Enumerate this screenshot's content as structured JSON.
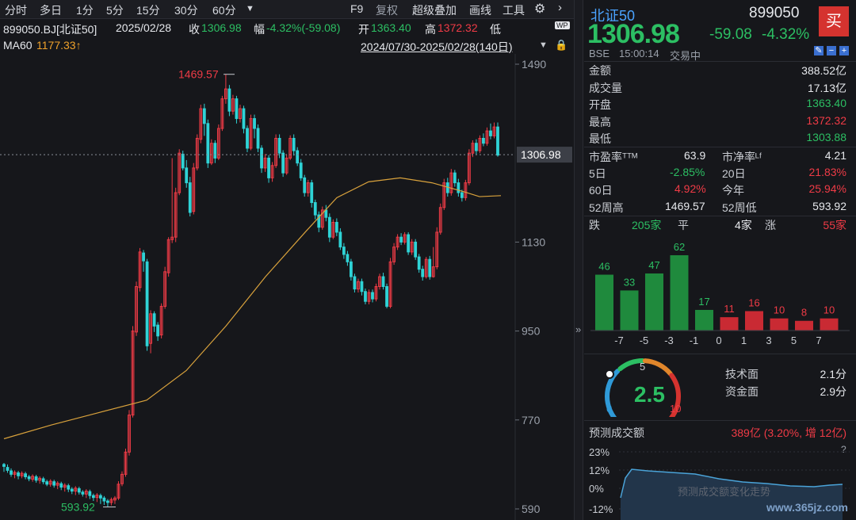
{
  "toolbar": {
    "periods": [
      "分时",
      "多日",
      "1分",
      "5分",
      "15分",
      "30分",
      "60分"
    ],
    "more_icon": "caret-down-icon",
    "f9": "F9",
    "restore": "复权",
    "overlay": "超级叠加",
    "draw": "画线",
    "tools": "工具",
    "settings_icon": "gear-icon",
    "next_icon": "chevron-right-icon"
  },
  "info": {
    "code": "899050.BJ[北证50]",
    "date": "2025/02/28",
    "close_label": "收",
    "close": "1306.98",
    "change_label": "幅",
    "change": "-4.32%(-59.08)",
    "open_label": "开",
    "open": "1363.40",
    "high_label": "高",
    "high": "1372.32",
    "low_label": "低",
    "ma_label": "MA60",
    "ma_value": "1177.33↑",
    "range": "2024/07/30-2025/02/28(140日)",
    "wp_icon": "WP"
  },
  "chart_data": {
    "type": "candlestick",
    "y_ticks": [
      "1490",
      "1130",
      "950",
      "770",
      "590"
    ],
    "ylim": [
      590,
      1490
    ],
    "current_price_label": "1306.98",
    "high_annotation": "1469.57",
    "low_annotation": "593.92",
    "ma_series": "MA60",
    "colors": {
      "up": "#ef3b46",
      "down": "#2fd3d6",
      "ma": "#d9a23c"
    },
    "candles": [
      [
        680,
        676,
        683,
        665
      ],
      [
        674,
        668,
        680,
        663
      ],
      [
        667,
        660,
        672,
        655
      ],
      [
        660,
        664,
        668,
        652
      ],
      [
        663,
        657,
        667,
        650
      ],
      [
        657,
        662,
        666,
        652
      ],
      [
        661,
        655,
        665,
        650
      ],
      [
        655,
        651,
        659,
        646
      ],
      [
        650,
        656,
        660,
        645
      ],
      [
        655,
        648,
        659,
        643
      ],
      [
        648,
        652,
        656,
        641
      ],
      [
        651,
        645,
        655,
        640
      ],
      [
        645,
        640,
        649,
        636
      ],
      [
        640,
        646,
        650,
        635
      ],
      [
        645,
        638,
        649,
        633
      ],
      [
        638,
        642,
        646,
        630
      ],
      [
        641,
        634,
        645,
        628
      ],
      [
        634,
        638,
        642,
        625
      ],
      [
        637,
        630,
        641,
        624
      ],
      [
        630,
        626,
        634,
        620
      ],
      [
        626,
        632,
        636,
        618
      ],
      [
        631,
        624,
        635,
        619
      ],
      [
        624,
        620,
        628,
        615
      ],
      [
        620,
        626,
        630,
        612
      ],
      [
        625,
        617,
        629,
        610
      ],
      [
        617,
        613,
        621,
        606
      ],
      [
        613,
        618,
        622,
        604
      ],
      [
        617,
        612,
        621,
        600
      ],
      [
        612,
        606,
        616,
        598
      ],
      [
        606,
        603,
        610,
        594
      ],
      [
        603,
        609,
        613,
        597
      ],
      [
        608,
        612,
        616,
        600
      ],
      [
        612,
        640,
        646,
        608
      ],
      [
        641,
        660,
        666,
        636
      ],
      [
        660,
        705,
        712,
        655
      ],
      [
        705,
        780,
        790,
        698
      ],
      [
        780,
        950,
        960,
        775
      ],
      [
        948,
        1040,
        1050,
        940
      ],
      [
        1038,
        1110,
        1118,
        1030
      ],
      [
        1108,
        1092,
        1114,
        1070
      ],
      [
        1090,
        920,
        1096,
        910
      ],
      [
        925,
        985,
        992,
        905
      ],
      [
        985,
        960,
        990,
        948
      ],
      [
        962,
        940,
        968,
        930
      ],
      [
        942,
        1000,
        1006,
        935
      ],
      [
        1000,
        1070,
        1080,
        995
      ],
      [
        1068,
        1135,
        1140,
        1060
      ],
      [
        1135,
        1140,
        1300,
        1128
      ],
      [
        1140,
        1230,
        1240,
        1130
      ],
      [
        1230,
        1310,
        1318,
        1225
      ],
      [
        1308,
        1280,
        1315,
        1275
      ],
      [
        1280,
        1250,
        1296,
        1240
      ],
      [
        1250,
        1190,
        1262,
        1182
      ],
      [
        1192,
        1280,
        1290,
        1186
      ],
      [
        1280,
        1340,
        1348,
        1275
      ],
      [
        1338,
        1400,
        1408,
        1330
      ],
      [
        1400,
        1370,
        1410,
        1345
      ],
      [
        1370,
        1290,
        1378,
        1280
      ],
      [
        1290,
        1330,
        1338,
        1286
      ],
      [
        1330,
        1300,
        1336,
        1290
      ],
      [
        1300,
        1360,
        1368,
        1296
      ],
      [
        1360,
        1420,
        1426,
        1355
      ],
      [
        1420,
        1440,
        1470,
        1410
      ],
      [
        1440,
        1395,
        1448,
        1385
      ],
      [
        1395,
        1420,
        1428,
        1388
      ],
      [
        1420,
        1380,
        1426,
        1370
      ],
      [
        1380,
        1400,
        1408,
        1372
      ],
      [
        1400,
        1360,
        1406,
        1350
      ],
      [
        1360,
        1320,
        1366,
        1312
      ],
      [
        1320,
        1380,
        1388,
        1316
      ],
      [
        1380,
        1360,
        1388,
        1340
      ],
      [
        1360,
        1320,
        1368,
        1312
      ],
      [
        1320,
        1280,
        1326,
        1270
      ],
      [
        1280,
        1300,
        1308,
        1272
      ],
      [
        1300,
        1260,
        1306,
        1250
      ],
      [
        1260,
        1285,
        1292,
        1252
      ],
      [
        1285,
        1340,
        1348,
        1280
      ],
      [
        1340,
        1310,
        1348,
        1300
      ],
      [
        1310,
        1270,
        1316,
        1262
      ],
      [
        1270,
        1300,
        1308,
        1266
      ],
      [
        1300,
        1340,
        1346,
        1296
      ],
      [
        1340,
        1315,
        1348,
        1305
      ],
      [
        1315,
        1290,
        1322,
        1284
      ],
      [
        1290,
        1260,
        1298,
        1254
      ],
      [
        1260,
        1230,
        1266,
        1222
      ],
      [
        1230,
        1250,
        1256,
        1222
      ],
      [
        1250,
        1210,
        1256,
        1200
      ],
      [
        1210,
        1185,
        1216,
        1176
      ],
      [
        1185,
        1160,
        1192,
        1150
      ],
      [
        1160,
        1195,
        1202,
        1155
      ],
      [
        1195,
        1180,
        1205,
        1172
      ],
      [
        1180,
        1140,
        1188,
        1130
      ],
      [
        1140,
        1170,
        1176,
        1136
      ],
      [
        1170,
        1150,
        1178,
        1142
      ],
      [
        1150,
        1120,
        1158,
        1114
      ],
      [
        1120,
        1105,
        1128,
        1096
      ],
      [
        1105,
        1090,
        1112,
        1082
      ],
      [
        1090,
        1060,
        1096,
        1052
      ],
      [
        1060,
        1035,
        1066,
        1028
      ],
      [
        1035,
        1050,
        1056,
        1028
      ],
      [
        1050,
        1030,
        1056,
        1022
      ],
      [
        1030,
        1010,
        1036,
        1004
      ],
      [
        1010,
        1028,
        1034,
        1004
      ],
      [
        1028,
        1015,
        1034,
        1008
      ],
      [
        1015,
        1040,
        1046,
        1010
      ],
      [
        1040,
        1060,
        1066,
        1034
      ],
      [
        1060,
        1040,
        1068,
        1034
      ],
      [
        1040,
        1000,
        1046,
        996
      ],
      [
        1000,
        1090,
        1098,
        996
      ],
      [
        1090,
        1120,
        1128,
        1084
      ],
      [
        1120,
        1140,
        1146,
        1114
      ],
      [
        1140,
        1130,
        1148,
        1124
      ],
      [
        1130,
        1145,
        1150,
        1125
      ],
      [
        1145,
        1110,
        1150,
        1104
      ],
      [
        1110,
        1130,
        1136,
        1104
      ],
      [
        1130,
        1100,
        1136,
        1094
      ],
      [
        1100,
        1075,
        1106,
        1068
      ],
      [
        1075,
        1060,
        1082,
        1052
      ],
      [
        1060,
        1095,
        1100,
        1056
      ],
      [
        1095,
        1060,
        1102,
        1054
      ],
      [
        1060,
        1080,
        1120,
        1058
      ],
      [
        1080,
        1150,
        1160,
        1075
      ],
      [
        1150,
        1200,
        1208,
        1145
      ],
      [
        1200,
        1250,
        1258,
        1195
      ],
      [
        1250,
        1230,
        1260,
        1222
      ],
      [
        1230,
        1270,
        1278,
        1224
      ],
      [
        1270,
        1250,
        1276,
        1242
      ],
      [
        1250,
        1230,
        1258,
        1222
      ],
      [
        1230,
        1220,
        1236,
        1212
      ],
      [
        1220,
        1250,
        1256,
        1214
      ],
      [
        1250,
        1310,
        1318,
        1245
      ],
      [
        1310,
        1330,
        1336,
        1302
      ],
      [
        1330,
        1315,
        1338,
        1308
      ],
      [
        1315,
        1340,
        1346,
        1310
      ],
      [
        1340,
        1330,
        1350,
        1324
      ],
      [
        1330,
        1355,
        1362,
        1325
      ],
      [
        1355,
        1345,
        1370,
        1338
      ],
      [
        1345,
        1363,
        1372,
        1340
      ],
      [
        1363,
        1306,
        1372,
        1303
      ]
    ],
    "ma": [
      [
        0,
        732
      ],
      [
        60,
        760
      ],
      [
        120,
        785
      ],
      [
        180,
        810
      ],
      [
        230,
        870
      ],
      [
        280,
        960
      ],
      [
        330,
        1060
      ],
      [
        380,
        1150
      ],
      [
        420,
        1220
      ],
      [
        460,
        1252
      ],
      [
        500,
        1260
      ],
      [
        540,
        1250
      ],
      [
        580,
        1232
      ],
      [
        600,
        1222
      ],
      [
        627,
        1224
      ]
    ]
  },
  "right": {
    "name": "北证50",
    "code": "899050",
    "price": "1306.98",
    "chg": "-59.08",
    "pct": "-4.32%",
    "buy": "买",
    "market": "BSE",
    "time": "15:00:14",
    "status": "交易中",
    "amount_label": "金额",
    "amount": "388.52亿",
    "volume_label": "成交量",
    "volume": "17.13亿",
    "open_label": "开盘",
    "open": "1363.40",
    "high_label": "最高",
    "high": "1372.32",
    "low_label": "最低",
    "low": "1303.88",
    "pe_label": "市盈率ᵀᵀᴹ",
    "pe": "63.9",
    "pb_label": "市净率ᴸᶠ",
    "pb": "4.21",
    "d5_label": "5日",
    "d5": "-2.85%",
    "d20_label": "20日",
    "d20": "21.83%",
    "d60_label": "60日",
    "d60": "4.92%",
    "ytd_label": "今年",
    "ytd": "25.94%",
    "wh_label": "52周高",
    "wh": "1469.57",
    "wl_label": "52周低",
    "wl": "593.92",
    "fall_label": "跌",
    "fall": "205家",
    "flat_label": "平",
    "flat": "4家",
    "rise_label": "涨",
    "rise": "55家",
    "dist_values": [
      "46",
      "33",
      "47",
      "62",
      "17",
      "11",
      "16",
      "10",
      "8",
      "10"
    ],
    "dist_axis": [
      "-7",
      "-5",
      "-3",
      "-1",
      "0",
      "1",
      "3",
      "5",
      "7"
    ],
    "gauge_value": "2.5",
    "gauge_min": "0",
    "gauge_mid": "5",
    "gauge_max": "10",
    "tech_label": "技术面",
    "tech": "2.1分",
    "fund_label": "资金面",
    "fund": "2.9分",
    "forecast_label": "预测成交额",
    "forecast_value": "389亿 (3.20%, 增 12亿)",
    "fc_ticks": [
      "23%",
      "12%",
      "0%",
      "-12%"
    ],
    "fc_caption": "预测成交额变化走势",
    "help": "?",
    "watermark": "www.365jz.com"
  }
}
